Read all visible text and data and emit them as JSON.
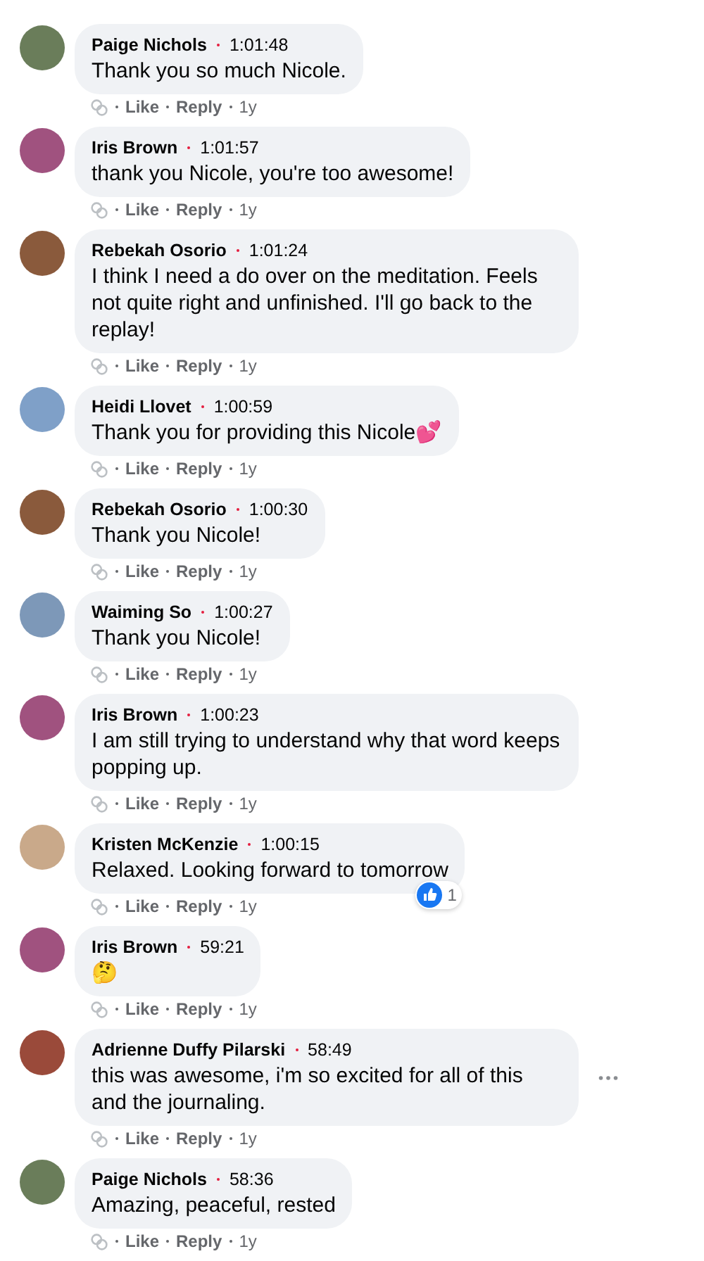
{
  "comments": [
    {
      "name": "Paige Nichols",
      "time": "1:01:48",
      "text": "Thank you so much Nicole.",
      "like": "Like",
      "reply": "Reply",
      "age": "1y",
      "menu_visible": false
    },
    {
      "name": "Iris Brown",
      "time": "1:01:57",
      "text": "thank you Nicole, you're too awesome!",
      "like": "Like",
      "reply": "Reply",
      "age": "1y",
      "menu_visible": false
    },
    {
      "name": "Rebekah Osorio",
      "time": "1:01:24",
      "text": "I think I need a do over on the meditation. Feels not quite right and unfinished. I'll go back to the replay!",
      "like": "Like",
      "reply": "Reply",
      "age": "1y",
      "menu_visible": false
    },
    {
      "name": "Heidi Llovet",
      "time": "1:00:59",
      "text": "Thank you for providing this Nicole💕",
      "like": "Like",
      "reply": "Reply",
      "age": "1y",
      "menu_visible": false
    },
    {
      "name": "Rebekah Osorio",
      "time": "1:00:30",
      "text": "Thank you Nicole!",
      "like": "Like",
      "reply": "Reply",
      "age": "1y",
      "menu_visible": false
    },
    {
      "name": "Waiming So",
      "time": "1:00:27",
      "text": "Thank you Nicole!",
      "like": "Like",
      "reply": "Reply",
      "age": "1y",
      "menu_visible": false
    },
    {
      "name": "Iris Brown",
      "time": "1:00:23",
      "text": "I am still trying to understand why that word keeps popping up.",
      "like": "Like",
      "reply": "Reply",
      "age": "1y",
      "menu_visible": false
    },
    {
      "name": "Kristen McKenzie",
      "time": "1:00:15",
      "text": "Relaxed. Looking forward to tomorrow",
      "like": "Like",
      "reply": "Reply",
      "age": "1y",
      "reaction": "1",
      "menu_visible": false
    },
    {
      "name": "Iris Brown",
      "time": "59:21",
      "text": "🤔",
      "like": "Like",
      "reply": "Reply",
      "age": "1y",
      "menu_visible": false
    },
    {
      "name": "Adrienne Duffy Pilarski",
      "time": "58:49",
      "text": "this was awesome, i'm so excited for all of this and the journaling.",
      "like": "Like",
      "reply": "Reply",
      "age": "1y",
      "menu_visible": true
    },
    {
      "name": "Paige Nichols",
      "time": "58:36",
      "text": "Amazing, peaceful, rested",
      "like": "Like",
      "reply": "Reply",
      "age": "1y",
      "menu_visible": false
    }
  ]
}
